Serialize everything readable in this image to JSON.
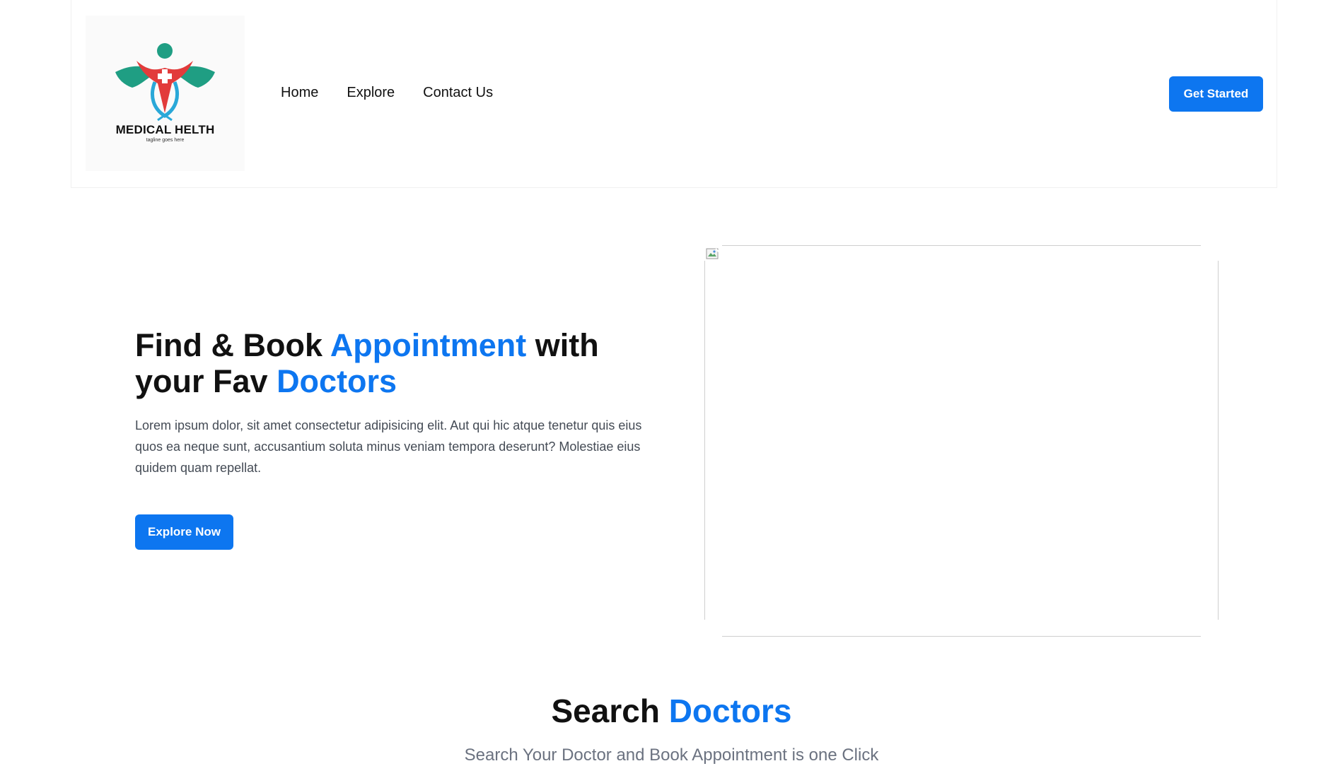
{
  "brand": {
    "name": "MEDICAL HELTH",
    "tagline": "tagline goes here",
    "logo_icon": "medical-figure-with-wings-icon",
    "colors": {
      "teal": "#1f9e83",
      "red": "#e23b3b",
      "blue": "#2aa8d8"
    }
  },
  "nav": {
    "items": [
      {
        "label": "Home"
      },
      {
        "label": "Explore"
      },
      {
        "label": "Contact Us"
      }
    ]
  },
  "header": {
    "cta_label": "Get Started"
  },
  "hero": {
    "title_part1": "Find & Book ",
    "title_accent1": "Appointment",
    "title_part2": " with your Fav ",
    "title_accent2": "Doctors",
    "description": "Lorem ipsum dolor, sit amet consectetur adipisicing elit. Aut qui hic atque tenetur quis eius quos ea neque sunt, accusantium soluta minus veniam tempora deserunt? Molestiae eius quidem quam repellat.",
    "cta_label": "Explore Now",
    "image_icon": "broken-image-icon"
  },
  "search": {
    "title_part1": "Search ",
    "title_accent": "Doctors",
    "subtitle": "Search Your Doctor and Book Appointment is one Click"
  },
  "theme": {
    "accent": "#0d76f0",
    "text": "#111111",
    "muted": "#6b7280"
  }
}
